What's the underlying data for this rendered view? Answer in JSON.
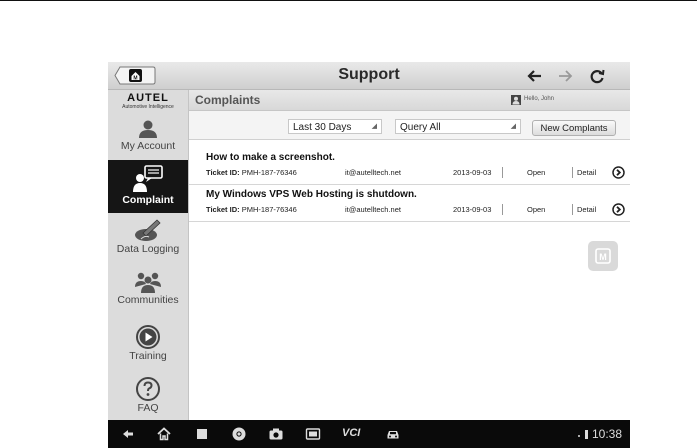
{
  "window": {
    "title": "Support"
  },
  "sidebar": {
    "brand": {
      "name": "AUTEL",
      "tagline": "Automotive Intelligence"
    },
    "items": [
      {
        "label": "My Account",
        "icon": "person-icon",
        "active": false
      },
      {
        "label": "Complaint",
        "icon": "complaint-icon",
        "active": true
      },
      {
        "label": "Data Logging",
        "icon": "data-logging-icon",
        "active": false
      },
      {
        "label": "Communities",
        "icon": "communities-icon",
        "active": false
      },
      {
        "label": "Training",
        "icon": "play-circle-icon",
        "active": false
      },
      {
        "label": "FAQ",
        "icon": "question-circle-icon",
        "active": false
      }
    ]
  },
  "content": {
    "title": "Complaints",
    "user_greeting": "Hello, John",
    "filters": {
      "date_range": "Last 30 Days",
      "query": "Query All",
      "new_button": "New Complants"
    },
    "tickets": [
      {
        "subject": "How to make a screenshot.",
        "id_label": "Ticket ID:",
        "id": "PMH-187-76346",
        "email": "it@autelltech.net",
        "date": "2013-09-03",
        "status": "Open",
        "detail": "Detail"
      },
      {
        "subject": "My Windows VPS Web Hosting is shutdown.",
        "id_label": "Ticket ID:",
        "id": "PMH-187-76346",
        "email": "it@autelltech.net",
        "date": "2013-09-03",
        "status": "Open",
        "detail": "Detail"
      }
    ]
  },
  "floating_badge": {
    "label": "M"
  },
  "navbar": {
    "icons": [
      "back-icon",
      "home-icon",
      "recent-apps-icon",
      "chrome-icon",
      "camera-icon",
      "screen-icon",
      "vci-icon",
      "car-icon"
    ],
    "vci_label": "VCI",
    "time": "10:38"
  },
  "colors": {
    "sidebar_active": "#151515",
    "sidebar_bg": "#dcdcdc",
    "navbar_bg": "#0a0a0a"
  }
}
